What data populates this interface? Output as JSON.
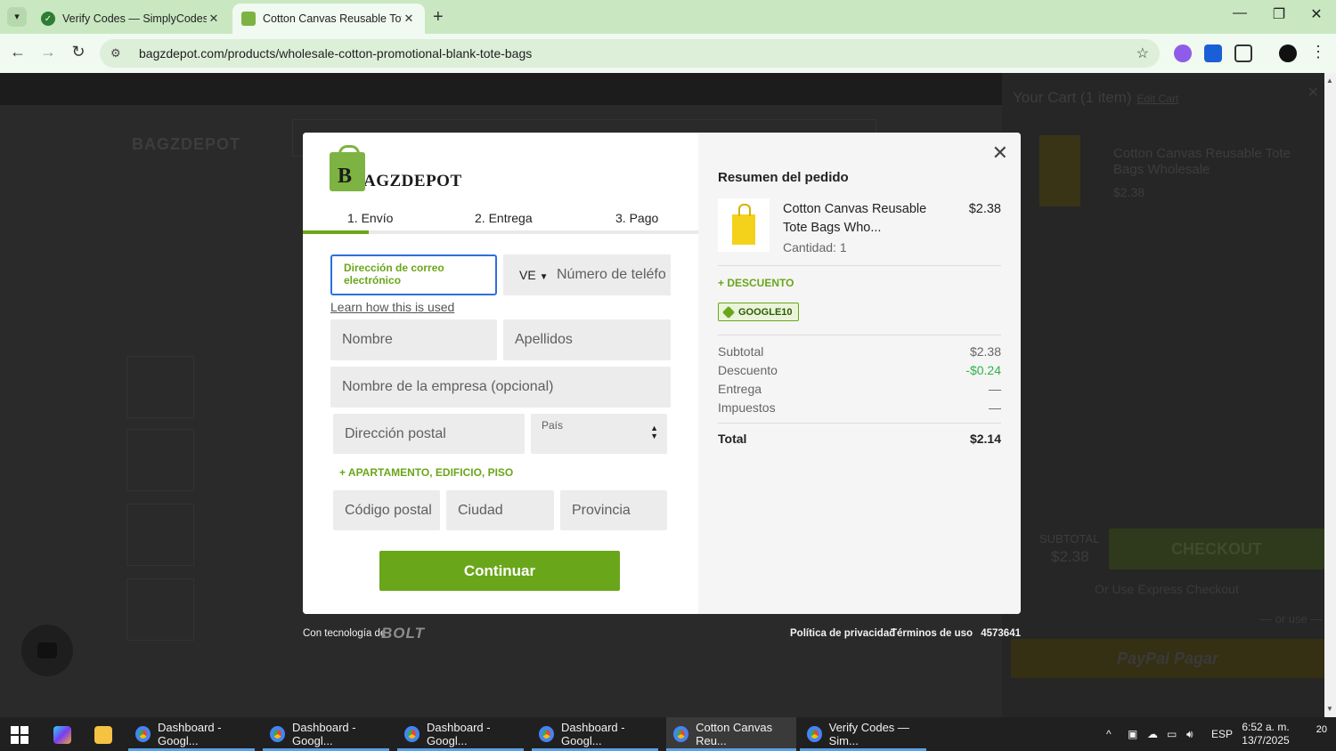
{
  "browser": {
    "tabs": [
      {
        "title": "Verify Codes — SimplyCodes",
        "active": false
      },
      {
        "title": "Cotton Canvas Reusable Tote B",
        "active": true
      }
    ],
    "url": "bagzdepot.com/products/wholesale-cotton-promotional-blank-tote-bags"
  },
  "background_page": {
    "logo": "BAGZDEPOT",
    "cart_header": "Your Cart (1 item)",
    "cart_edit": "Edit Cart",
    "cart_item_name": "Cotton Canvas Reusable Tote Bags Wholesale",
    "cart_item_price": "$2.38",
    "subtotal_label": "SUBTOTAL",
    "subtotal_value": "$2.38",
    "checkout_label": "CHECKOUT",
    "express_text": "Or Use Express Checkout",
    "or_use": "— or use —",
    "paypal_label": "PayPal Pagar"
  },
  "checkout": {
    "brand_mark": "B",
    "brand_word": "AGZDEPOT",
    "steps": [
      "1. Envío",
      "2. Entrega",
      "3. Pago"
    ],
    "active_step": 0,
    "fields": {
      "email_label": "Dirección de correo electrónico",
      "phone_country": "VE",
      "phone_placeholder": "Número de teléfono",
      "first_name": "Nombre",
      "last_name": "Apellidos",
      "company": "Nombre de la empresa (opcional)",
      "address": "Dirección postal",
      "country_label": "País",
      "postal": "Código postal",
      "city": "Ciudad",
      "province": "Provincia"
    },
    "learn_link": "Learn how this is used",
    "apt_link": "+ APARTAMENTO, EDIFICIO, PISO",
    "continue_label": "Continuar"
  },
  "summary": {
    "title": "Resumen del pedido",
    "item_name": "Cotton Canvas Reusable Tote Bags Who...",
    "item_qty": "Cantidad: 1",
    "item_price": "$2.38",
    "discount_link": "+ DESCUENTO",
    "coupon_code": "GOOGLE10",
    "rows": [
      {
        "label": "Subtotal",
        "value": "$2.38"
      },
      {
        "label": "Descuento",
        "value": "-$0.24"
      },
      {
        "label": "Entrega",
        "value": "—"
      },
      {
        "label": "Impuestos",
        "value": "—"
      }
    ],
    "total_label": "Total",
    "total_value": "$2.14"
  },
  "footer": {
    "powered": "Con tecnología de",
    "bolt": "BOLT",
    "privacy": "Política de privacidad",
    "terms": "Términos de uso",
    "id": "4573641"
  },
  "taskbar": {
    "apps": [
      {
        "label": "Dashboard - Googl..."
      },
      {
        "label": "Dashboard - Googl..."
      },
      {
        "label": "Dashboard - Googl..."
      },
      {
        "label": "Dashboard - Googl..."
      },
      {
        "label": "Cotton Canvas Reu..."
      },
      {
        "label": "Verify Codes — Sim..."
      }
    ],
    "lang": "ESP",
    "time": "6:52 a. m.",
    "date": "13/7/2025",
    "notifications": "20"
  },
  "colors": {
    "brand_green": "#6aa61a",
    "discount_green": "#2db34a",
    "focus_blue": "#2f6fdc"
  }
}
